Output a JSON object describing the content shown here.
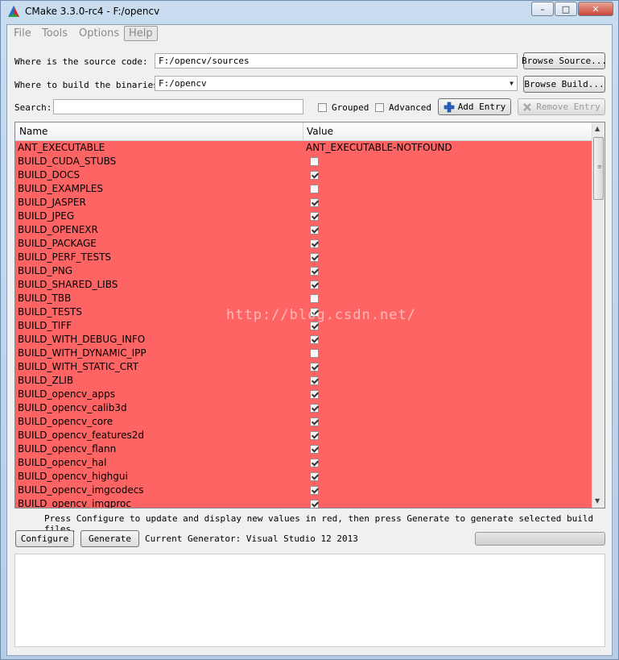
{
  "window": {
    "title": "CMake 3.3.0-rc4 - F:/opencv",
    "minimize": "–",
    "restore": "□",
    "close": "✕"
  },
  "menu": {
    "file": "File",
    "tools": "Tools",
    "options": "Options",
    "help": "Help"
  },
  "source": {
    "label": "Where is the source code:",
    "value": "F:/opencv/sources",
    "button": "Browse Source..."
  },
  "build": {
    "label": "Where to build the binaries:",
    "value": "F:/opencv",
    "button": "Browse Build..."
  },
  "search": {
    "label": "Search:",
    "value": "",
    "grouped_label": "Grouped",
    "advanced_label": "Advanced",
    "add_entry": "Add Entry",
    "remove_entry": "Remove Entry"
  },
  "table": {
    "col_name": "Name",
    "col_value": "Value",
    "rows": [
      {
        "name": "ANT_EXECUTABLE",
        "type": "text",
        "value": "ANT_EXECUTABLE-NOTFOUND"
      },
      {
        "name": "BUILD_CUDA_STUBS",
        "type": "bool",
        "checked": false
      },
      {
        "name": "BUILD_DOCS",
        "type": "bool",
        "checked": true
      },
      {
        "name": "BUILD_EXAMPLES",
        "type": "bool",
        "checked": false
      },
      {
        "name": "BUILD_JASPER",
        "type": "bool",
        "checked": true
      },
      {
        "name": "BUILD_JPEG",
        "type": "bool",
        "checked": true
      },
      {
        "name": "BUILD_OPENEXR",
        "type": "bool",
        "checked": true
      },
      {
        "name": "BUILD_PACKAGE",
        "type": "bool",
        "checked": true
      },
      {
        "name": "BUILD_PERF_TESTS",
        "type": "bool",
        "checked": true
      },
      {
        "name": "BUILD_PNG",
        "type": "bool",
        "checked": true
      },
      {
        "name": "BUILD_SHARED_LIBS",
        "type": "bool",
        "checked": true
      },
      {
        "name": "BUILD_TBB",
        "type": "bool",
        "checked": false
      },
      {
        "name": "BUILD_TESTS",
        "type": "bool",
        "checked": true
      },
      {
        "name": "BUILD_TIFF",
        "type": "bool",
        "checked": true
      },
      {
        "name": "BUILD_WITH_DEBUG_INFO",
        "type": "bool",
        "checked": true
      },
      {
        "name": "BUILD_WITH_DYNAMIC_IPP",
        "type": "bool",
        "checked": false
      },
      {
        "name": "BUILD_WITH_STATIC_CRT",
        "type": "bool",
        "checked": true
      },
      {
        "name": "BUILD_ZLIB",
        "type": "bool",
        "checked": true
      },
      {
        "name": "BUILD_opencv_apps",
        "type": "bool",
        "checked": true
      },
      {
        "name": "BUILD_opencv_calib3d",
        "type": "bool",
        "checked": true
      },
      {
        "name": "BUILD_opencv_core",
        "type": "bool",
        "checked": true
      },
      {
        "name": "BUILD_opencv_features2d",
        "type": "bool",
        "checked": true
      },
      {
        "name": "BUILD_opencv_flann",
        "type": "bool",
        "checked": true
      },
      {
        "name": "BUILD_opencv_hal",
        "type": "bool",
        "checked": true
      },
      {
        "name": "BUILD_opencv_highgui",
        "type": "bool",
        "checked": true
      },
      {
        "name": "BUILD_opencv_imgcodecs",
        "type": "bool",
        "checked": true
      },
      {
        "name": "BUILD_opencv_imgproc",
        "type": "bool",
        "checked": true
      }
    ],
    "row_color": "#ff6464"
  },
  "status": {
    "hint": "Press Configure to update and display new values in red, then press Generate to generate selected build files.",
    "configure": "Configure",
    "generate": "Generate",
    "generator": "Current Generator: Visual Studio 12 2013",
    "progress": 0
  },
  "watermark": "http://blog.csdn.net/"
}
